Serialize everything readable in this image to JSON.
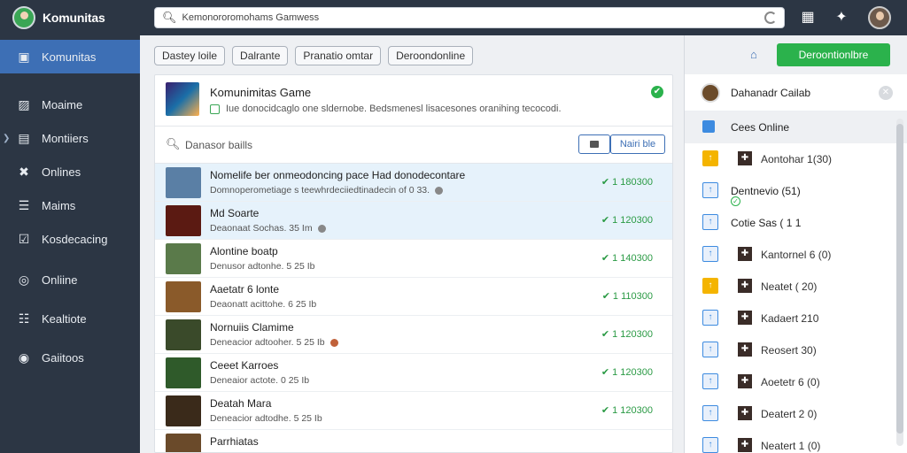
{
  "app": {
    "title": "Komunitas"
  },
  "search": {
    "value": "Kemonororomohams Gamwess"
  },
  "sidebar": {
    "items": [
      {
        "label": "Komunitas",
        "icon": "square-icon",
        "active": true
      },
      {
        "label": "Moaime",
        "icon": "image-icon",
        "active": false
      },
      {
        "label": "Montiiers",
        "icon": "tablet-icon",
        "active": false
      },
      {
        "label": "Onlines",
        "icon": "cross-icon",
        "active": false
      },
      {
        "label": "Maims",
        "icon": "list-icon",
        "active": false
      },
      {
        "label": "Kosdecacing",
        "icon": "check-square-icon",
        "active": false
      },
      {
        "label": "Onliine",
        "icon": "circle-icon",
        "active": false
      },
      {
        "label": "Kealtiote",
        "icon": "building-icon",
        "active": false
      },
      {
        "label": "Gaiitoos",
        "icon": "target-icon",
        "active": false
      }
    ]
  },
  "filters": [
    "Dastey loile",
    "Dalrante",
    "Pranatio omtar",
    "Deroondonline"
  ],
  "game": {
    "title": "Komunimitas Game",
    "subtitle": "Iue donocidcaglo one sldernobe. Bedsmenesl lisacesones oranihing tecocodi."
  },
  "list_search": {
    "placeholder": "Danasor baills",
    "manage_label": "Nairi ble"
  },
  "rows": [
    {
      "title": "Nomelife ber onmeodoncing pace Had donodecontare",
      "sub": "Domnoperometiage s teewhrdeciiedtinadecin of 0 33.",
      "value": "1 180300",
      "thumb": "#5a7fa5",
      "dot": "#888888",
      "selected": true
    },
    {
      "title": "Md Soarte",
      "sub": "Deaonaat Sochas. 35 Im",
      "value": "1 120300",
      "thumb": "#5b1a12",
      "dot": "#888888",
      "selected": true
    },
    {
      "title": "Alontine boatp",
      "sub": "Denusor adtonhe. 5 25 Ib",
      "value": "1 140300",
      "thumb": "#5a7a4a",
      "dot": "",
      "selected": false
    },
    {
      "title": "Aaetatr 6 lonte",
      "sub": "Deaonatt acittohe. 6 25 Ib",
      "value": "1 110300",
      "thumb": "#8a5a2a",
      "dot": "",
      "selected": false
    },
    {
      "title": "Nornuiis Clamime",
      "sub": "Deneacior adtooher. 5 25 Ib",
      "value": "1 120300",
      "thumb": "#3a4a2a",
      "dot": "#c0613a",
      "selected": false
    },
    {
      "title": "Ceeet Karroes",
      "sub": "Deneaior actote. 0 25 Ib",
      "value": "1 120300",
      "thumb": "#2f5a2a",
      "dot": "",
      "selected": false
    },
    {
      "title": "Deatah Mara",
      "sub": "Deneacior adtodhe. 5 25 Ib",
      "value": "1 120300",
      "thumb": "#3a2a1a",
      "dot": "",
      "selected": false
    },
    {
      "title": "Parrhiatas",
      "sub": "",
      "value": "",
      "thumb": "#6a4a2a",
      "dot": "",
      "selected": false
    }
  ],
  "right": {
    "cta_label": "Deroontionlbre",
    "profile_name": "Dahanadr Cailab",
    "online_label": "Cees Online",
    "items": [
      {
        "label": "Aontohar 1(30)",
        "icon_style": "yellow",
        "kind": "sub"
      },
      {
        "label": "Dentnevio (51)",
        "icon_style": "blue",
        "kind": "big",
        "ok": true
      },
      {
        "label": "Cotie Sas ( 1 1",
        "icon_style": "blue",
        "kind": "big"
      },
      {
        "label": "Kantornel 6 (0)",
        "icon_style": "blue",
        "kind": "sub"
      },
      {
        "label": "Neatet ( 20)",
        "icon_style": "yellow",
        "kind": "sub"
      },
      {
        "label": "Kadaert 210",
        "icon_style": "blue",
        "kind": "sub"
      },
      {
        "label": "Reosert 30)",
        "icon_style": "blue",
        "kind": "sub"
      },
      {
        "label": "Aoetetr 6 (0)",
        "icon_style": "blue",
        "kind": "sub"
      },
      {
        "label": "Deatert 2 0)",
        "icon_style": "blue",
        "kind": "sub"
      },
      {
        "label": "Neatert 1 (0)",
        "icon_style": "blue",
        "kind": "sub"
      }
    ]
  },
  "colors": {
    "sidebar_bg": "#2c3644",
    "active": "#3d6fb5",
    "green": "#2bb24c"
  }
}
